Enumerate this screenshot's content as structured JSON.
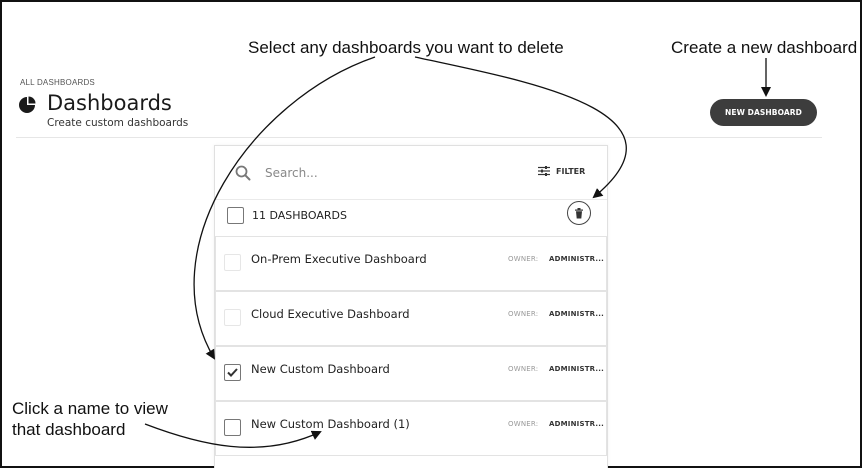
{
  "annotations": {
    "select": "Select any dashboards you want to delete",
    "create": "Create a new dashboard",
    "click": "Click a name to view that dashboard"
  },
  "header": {
    "breadcrumb": "ALL DASHBOARDS",
    "title": "Dashboards",
    "subtitle": "Create custom dashboards",
    "title_icon": "pie-chart-icon",
    "new_button_label": "NEW DASHBOARD"
  },
  "search": {
    "placeholder": "Search...",
    "filter_label": "FILTER"
  },
  "list": {
    "count_label": "11 DASHBOARDS",
    "delete_icon": "trash-icon",
    "rows": [
      {
        "name": "On-Prem Executive Dashboard",
        "owner_label": "OWNER:",
        "owner": "ADMINISTR...",
        "checked": false
      },
      {
        "name": "Cloud Executive Dashboard",
        "owner_label": "OWNER:",
        "owner": "ADMINISTR...",
        "checked": false
      },
      {
        "name": "New Custom Dashboard",
        "owner_label": "OWNER:",
        "owner": "ADMINISTR...",
        "checked": true
      },
      {
        "name": "New Custom Dashboard (1)",
        "owner_label": "OWNER:",
        "owner": "ADMINISTR...",
        "checked": false
      }
    ]
  },
  "colors": {
    "button_bg": "#3d3d3d",
    "border": "#e3e3e3"
  }
}
